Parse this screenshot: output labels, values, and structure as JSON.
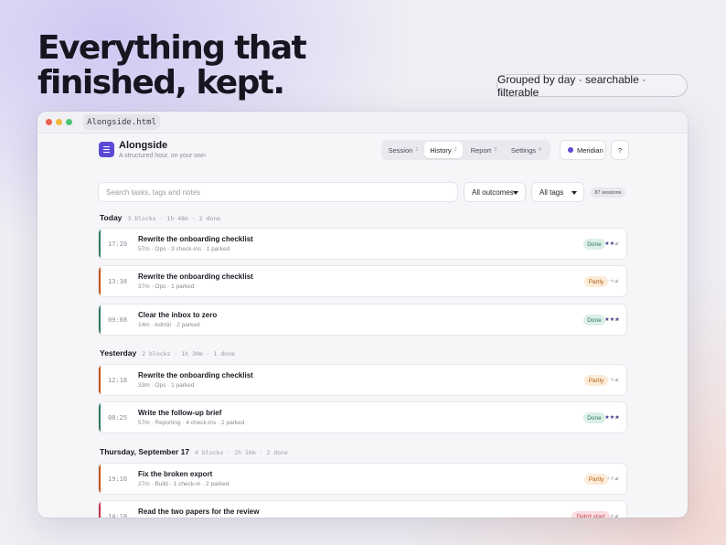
{
  "headline": {
    "line1": "Everything that",
    "line2": "finished, kept."
  },
  "feature_pill": "Grouped by day · searchable · filterable",
  "window": {
    "tab_title": "Alongside.html"
  },
  "app": {
    "name": "Alongside",
    "tagline": "A structured hour, on your own"
  },
  "nav": [
    {
      "label": "Session",
      "count": "1"
    },
    {
      "label": "History",
      "count": "2"
    },
    {
      "label": "Report",
      "count": "3"
    },
    {
      "label": "Settings",
      "count": "4"
    }
  ],
  "user": {
    "name": "Meridian"
  },
  "help": {
    "label": "?"
  },
  "filters": {
    "search_placeholder": "Search tasks, tags and notes",
    "outcome": "All outcomes",
    "tags": "All tags",
    "sessions_count": "87 sessions"
  },
  "colors": {
    "accent": "#5b4bd4",
    "done_bar": "#2f7a62",
    "partly_bar": "#c4541a",
    "didnt_bar": "#c43245",
    "done_badge_bg": "#dcefe7",
    "done_badge_text": "#2f7a62",
    "partly_badge_bg": "#fcebd7",
    "partly_badge_text": "#b0601a",
    "didnt_badge_bg": "#fadde1",
    "didnt_badge_text": "#c43245"
  },
  "groups": [
    {
      "title": "Today",
      "meta": "3 blocks · 1h 48m · 2 done"
    },
    {
      "title": "Yesterday",
      "meta": "2 blocks · 1h 30m · 1 done"
    },
    {
      "title": "Thursday, September 17",
      "meta": "4 blocks · 2h 16m · 2 done"
    }
  ],
  "entries": [
    {
      "time": "17:20",
      "task": "Rewrite the onboarding checklist",
      "meta": "57m · Ops · 3 check-ins · 1 parked",
      "rating": 4,
      "status": "Done",
      "kind": "done"
    },
    {
      "time": "13:38",
      "task": "Rewrite the onboarding checklist",
      "meta": "37m · Ops · 1 parked",
      "rating": 2,
      "status": "Partly",
      "kind": "partly"
    },
    {
      "time": "09:08",
      "task": "Clear the inbox to zero",
      "meta": "14m · Admin · 2 parked",
      "rating": 5,
      "status": "Done",
      "kind": "done"
    },
    {
      "time": "12:18",
      "task": "Rewrite the onboarding checklist",
      "meta": "33m · Ops · 1 parked",
      "rating": 2,
      "status": "Partly",
      "kind": "partly"
    },
    {
      "time": "08:25",
      "task": "Write the follow-up brief",
      "meta": "57m · Reporting · 4 check-ins · 2 parked",
      "rating": 5,
      "status": "Done",
      "kind": "done"
    },
    {
      "time": "19:16",
      "task": "Fix the broken export",
      "meta": "27m · Build · 1 check-in · 2 parked",
      "rating": 3,
      "status": "Partly",
      "kind": "partly"
    },
    {
      "time": "14:18",
      "task": "Read the two papers for the review",
      "meta": "",
      "rating": 2,
      "status": "Didn't start",
      "kind": "didnt"
    }
  ],
  "stars_max": 5,
  "more_glyph": "⌄"
}
